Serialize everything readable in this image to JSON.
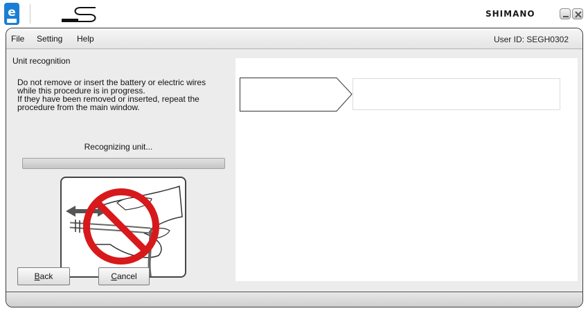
{
  "titlebar": {
    "app_icon": "etube-logo-icon",
    "s_logo": "shimano-s-logo-icon",
    "brand": "SHIMANO",
    "minimize_icon": "minimize-icon",
    "close_icon": "close-icon"
  },
  "menu": {
    "items": [
      "File",
      "Setting",
      "Help"
    ],
    "user_id": "User ID: SEGH0302"
  },
  "left_panel": {
    "heading": "Unit recognition",
    "warning_lines": [
      "Do not remove or insert the battery or electric wires",
      "while this procedure is in progress.",
      "If they have been removed or inserted, repeat the",
      "procedure from the main window."
    ],
    "status": "Recognizing unit...",
    "progress": 0,
    "illustration_icon": "do-not-disconnect-wire-icon",
    "back_button": {
      "mnemonic": "B",
      "rest": "ack"
    },
    "cancel_button": {
      "mnemonic": "C",
      "rest": "ancel"
    }
  },
  "colors": {
    "prohibit_red": "#d7191c",
    "arrow_gray": "#555555",
    "etube_blue": "#1a7fd4"
  }
}
